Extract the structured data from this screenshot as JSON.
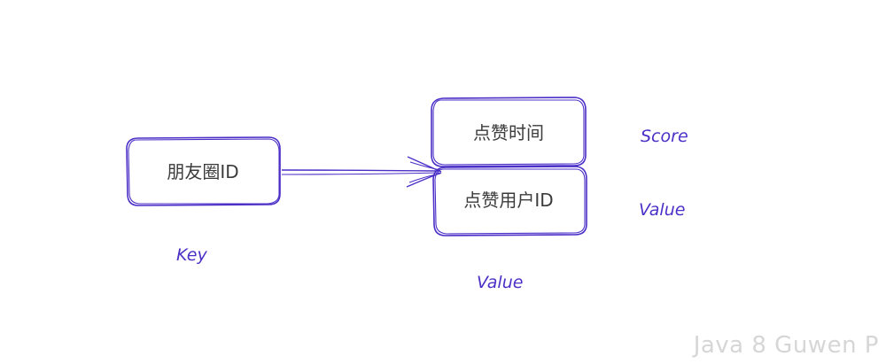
{
  "diagram": {
    "key_box": {
      "label": "朋友圈ID"
    },
    "score_box": {
      "label": "点赞时间"
    },
    "value_box": {
      "label": "点赞用户ID"
    },
    "labels": {
      "key": "Key",
      "score": "Score",
      "member": "Value",
      "value": "Value"
    },
    "stroke_color": "#4b2fc7"
  },
  "watermark": "Java 8 Guwen P"
}
